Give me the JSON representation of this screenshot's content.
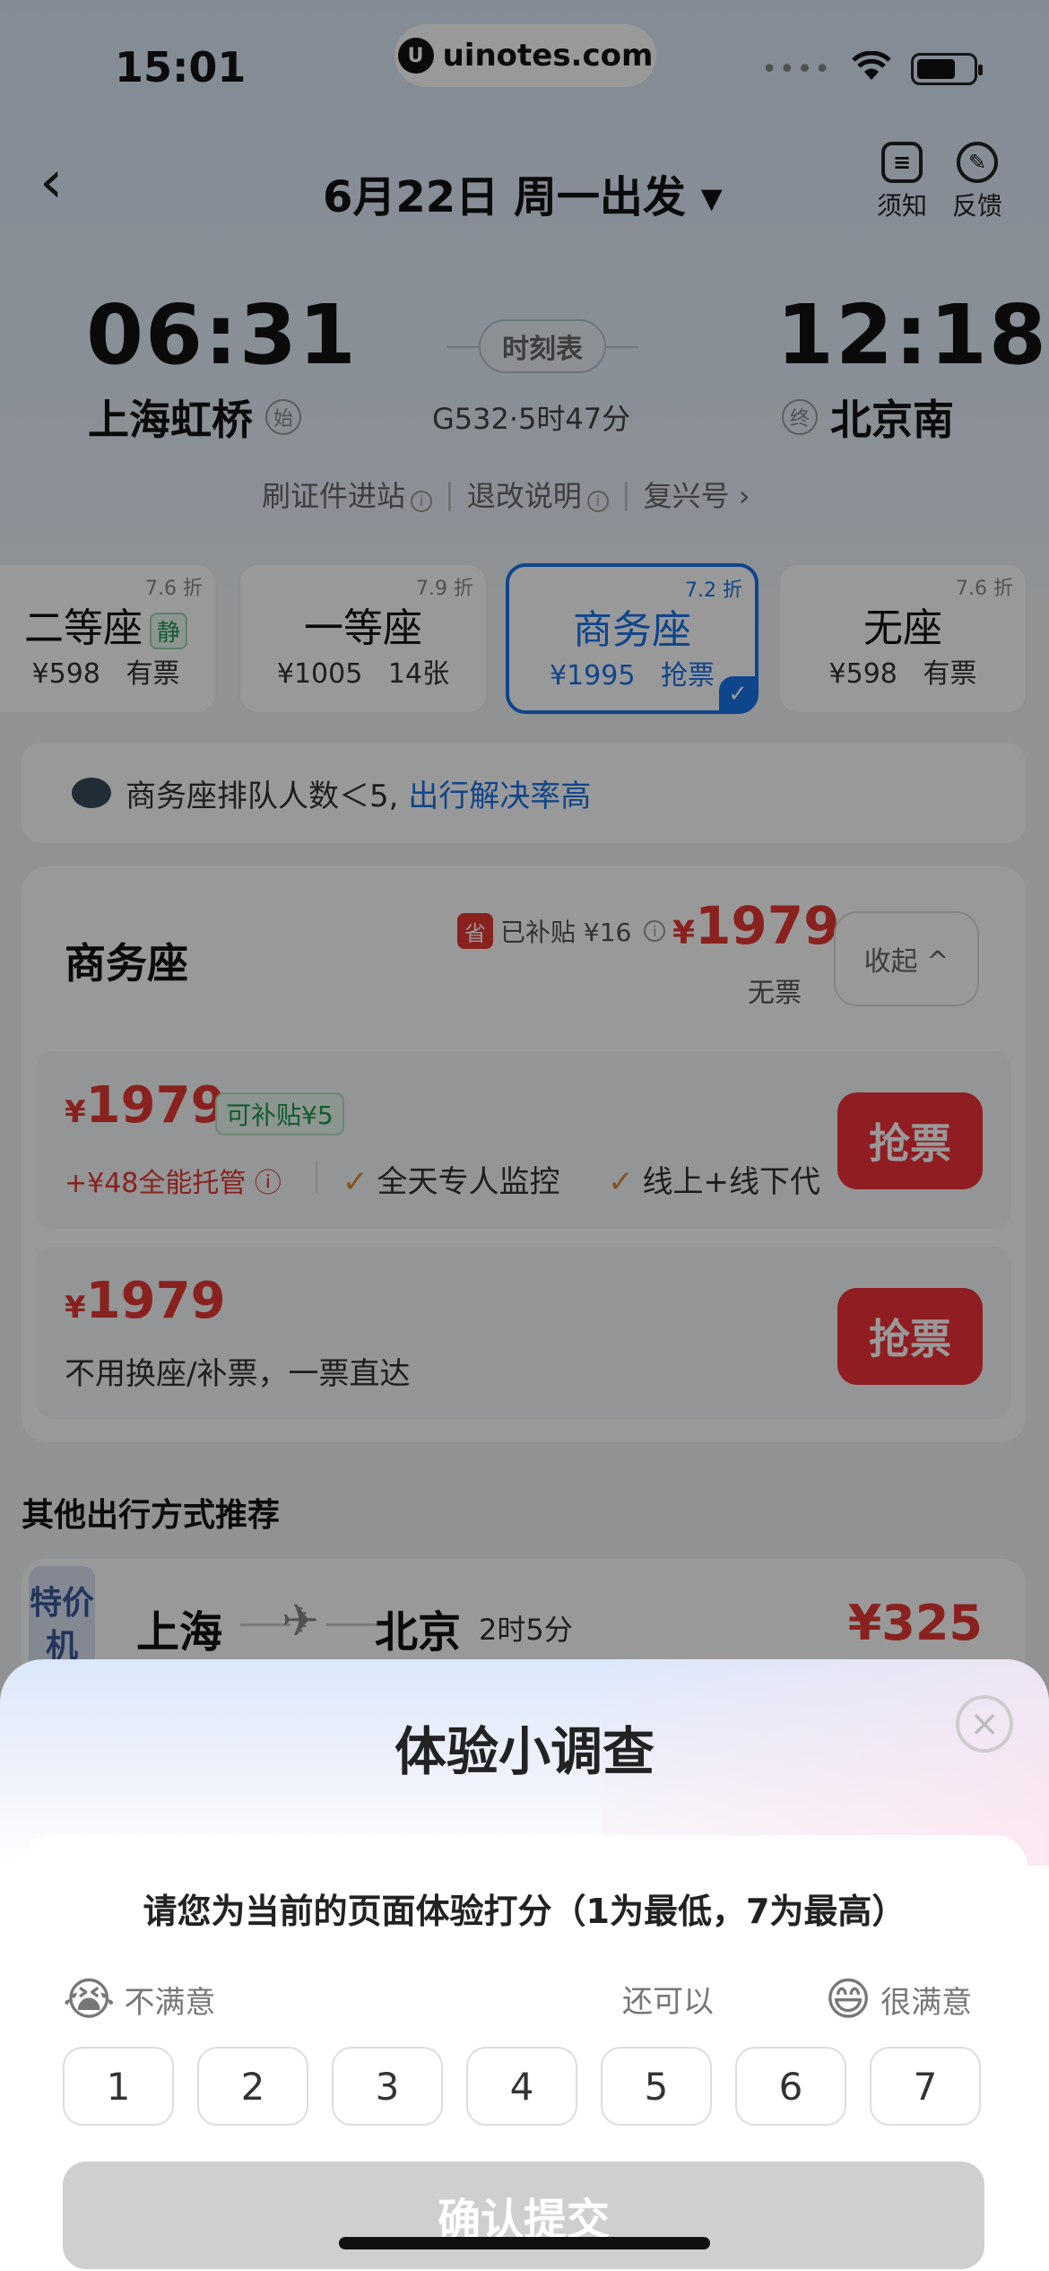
{
  "status_bar": {
    "time": "15:01",
    "watermark": "uinotes.com",
    "watermark_logo": "U",
    "dots": "••••",
    "wifi_icon": "wifi-icon",
    "battery_icon": "battery-icon"
  },
  "header": {
    "back_icon": "‹",
    "title": "6月22日 周一出发 ▾",
    "notice_label": "须知",
    "notice_glyph": "≡",
    "feedback_label": "反馈",
    "feedback_glyph": "✎"
  },
  "train": {
    "depart_time": "06:31",
    "arrive_time": "12:18",
    "depart_station": "上海虹桥",
    "depart_tag": "始",
    "arrive_station": "北京南",
    "arrive_tag": "终",
    "timetable_label": "时刻表",
    "info": "G532·5时47分"
  },
  "notes": {
    "item1": "刷证件进站",
    "item2": "退改说明",
    "item3": "复兴号 ›",
    "info_glyph": "i",
    "sep": "|"
  },
  "seats": [
    {
      "name": "二等座",
      "quiet": "静",
      "price": "¥598",
      "stock": "有票",
      "discount": "7.6 折"
    },
    {
      "name": "一等座",
      "price": "¥1005",
      "stock": "14张",
      "discount": "7.9 折"
    },
    {
      "name": "商务座",
      "price": "¥1995",
      "stock": "抢票",
      "discount": "7.2 折",
      "check": "✓"
    },
    {
      "name": "无座",
      "price": "¥598",
      "stock": "有票",
      "discount": "7.6 折"
    }
  ],
  "queue": {
    "text": "商务座排队人数＜5,",
    "highlight": "出行解决率高"
  },
  "panel": {
    "title": "商务座",
    "subsidy_icon": "省",
    "subsidy_text": "已补贴 ¥16",
    "info_glyph": "i",
    "price_symbol": "¥",
    "price": "1979",
    "no_ticket": "无票",
    "collapse": "收起 ^",
    "option1": {
      "price_symbol": "¥",
      "price": "1979",
      "badge": "可补贴¥5",
      "sub": "+¥48全能托管 ⓘ",
      "feature1": "全天专人监控",
      "feature2": "线上+线下代",
      "tick": "✓",
      "button": "抢票"
    },
    "option2": {
      "price_symbol": "¥",
      "price": "1979",
      "desc": "不用换座/补票，一票直达",
      "button": "抢票"
    }
  },
  "other": {
    "section_title": "其他出行方式推荐",
    "tag": "特价机",
    "from": "上海",
    "plane_glyph": "✈",
    "to": "北京",
    "duration": "2时5分",
    "price": "¥325"
  },
  "survey": {
    "title": "体验小调查",
    "close_glyph": "×",
    "question": "请您为当前的页面体验打分（1为最低，7为最高）",
    "low_emoji": "😭",
    "low_label": "不满意",
    "mid_label": "还可以",
    "high_emoji": "😄",
    "high_label": "很满意",
    "ratings": [
      "1",
      "2",
      "3",
      "4",
      "5",
      "6",
      "7"
    ],
    "submit": "确认提交"
  },
  "colors": {
    "accent": "#1a73e8",
    "price_red": "#e53935",
    "grab_red": "#f0313a",
    "submit_disabled": "#cfcfcf"
  }
}
